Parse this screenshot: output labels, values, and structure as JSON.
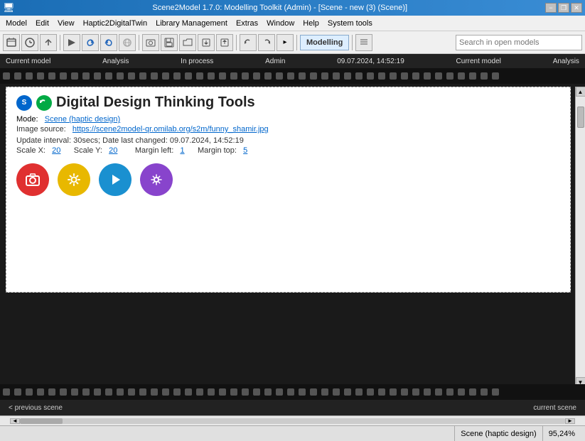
{
  "titlebar": {
    "title": "Scene2Model 1.7.0: Modelling Toolkit (Admin) - [Scene - new (3) (Scene)]",
    "min": "−",
    "restore": "❐",
    "close": "✕"
  },
  "menubar": {
    "items": [
      "Model",
      "Edit",
      "View",
      "Haptic2DigitalTwin",
      "Library Management",
      "Extras",
      "Window",
      "Help",
      "System tools"
    ]
  },
  "toolbar": {
    "label": "Modelling",
    "search_placeholder": "Search in open models"
  },
  "canvas_header": {
    "current_model": "Current model",
    "analysis": "Analysis",
    "in_process": "In process",
    "admin": "Admin",
    "timestamp": "09.07.2024, 14:52:19",
    "current_model2": "Current model",
    "analysis2": "Analysis"
  },
  "content": {
    "title": "Digital Design Thinking Tools",
    "mode_label": "Mode:",
    "mode_link": "Scene (haptic design)",
    "image_source_label": "Image source:",
    "image_source_url": "https://scene2model-qr.omilab.org/s2m/funny_shamir.jpg",
    "update_info": "Update interval: 30secs; Date last changed: 09.07.2024, 14:52:19",
    "scale_x_label": "Scale X:",
    "scale_x_value": "20",
    "scale_y_label": "Scale Y:",
    "scale_y_value": "20",
    "margin_left_label": "Margin left:",
    "margin_left_value": "1",
    "margin_top_label": "Margin top:",
    "margin_top_value": "5"
  },
  "action_buttons": [
    {
      "name": "camera-button",
      "icon": "📷",
      "color": "#e03030",
      "label": "camera"
    },
    {
      "name": "settings-button",
      "icon": "⚙",
      "color": "#e8b800",
      "label": "settings"
    },
    {
      "name": "play-button",
      "icon": "▶",
      "color": "#1a90d0",
      "label": "play"
    },
    {
      "name": "gear-button",
      "icon": "✦",
      "color": "#8844cc",
      "label": "gear"
    }
  ],
  "navigation": {
    "prev": "< previous scene",
    "current": "current scene"
  },
  "statusbar": {
    "scene": "Scene (haptic design)",
    "zoom": "95,24%"
  }
}
